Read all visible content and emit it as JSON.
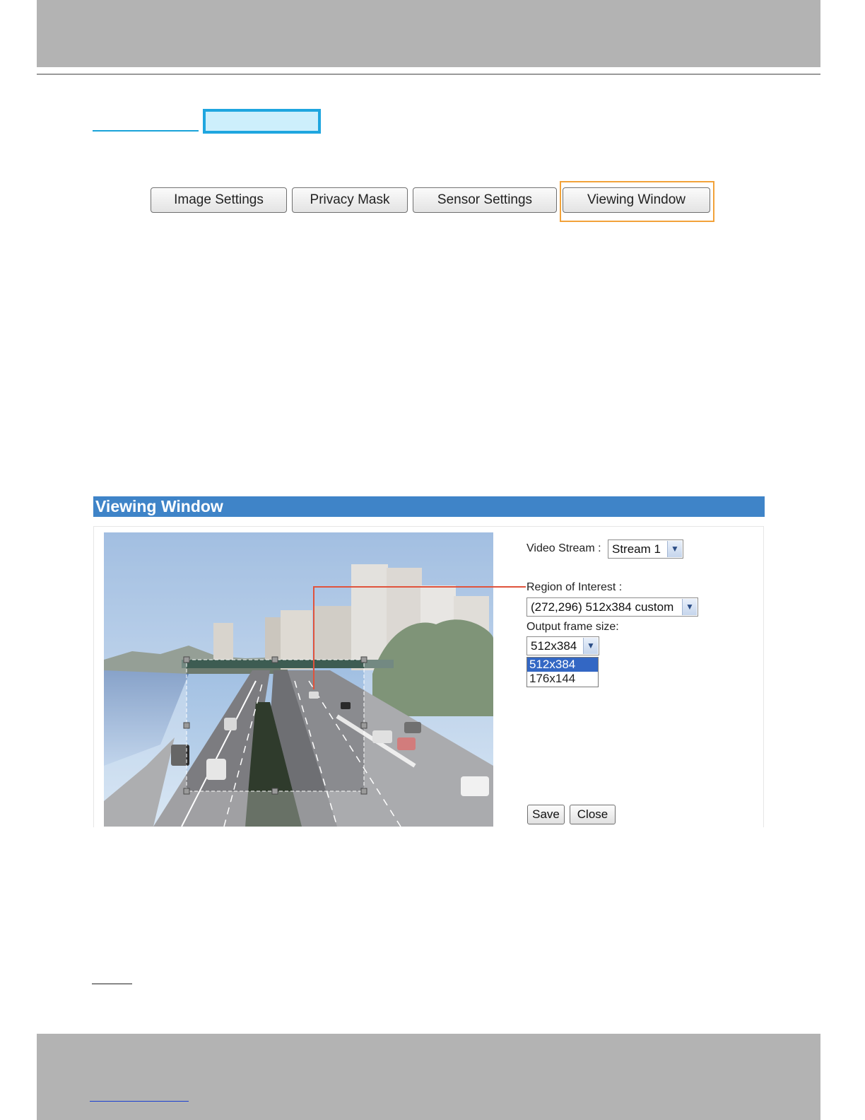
{
  "tabs": [
    {
      "label": "Image Settings",
      "active": false
    },
    {
      "label": "Privacy Mask",
      "active": false
    },
    {
      "label": "Sensor Settings",
      "active": false
    },
    {
      "label": "Viewing Window",
      "active": true
    }
  ],
  "panel": {
    "title": "Viewing Window",
    "video_stream": {
      "label": "Video Stream :",
      "value": "Stream 1"
    },
    "region_of_interest": {
      "label": "Region of Interest :",
      "value": "(272,296) 512x384 custom"
    },
    "output_frame_size": {
      "label": "Output frame size:",
      "value": "512x384",
      "options": [
        {
          "label": "512x384",
          "selected": true
        },
        {
          "label": "176x144",
          "selected": false
        }
      ]
    },
    "buttons": {
      "save": "Save",
      "close": "Close"
    }
  },
  "colors": {
    "accent_header": "#3f84c8",
    "tab_highlight": "#f2a23a",
    "callout_line": "#e0533c",
    "link_highlight": "#1fa6df",
    "band_gray": "#b3b3b3"
  }
}
